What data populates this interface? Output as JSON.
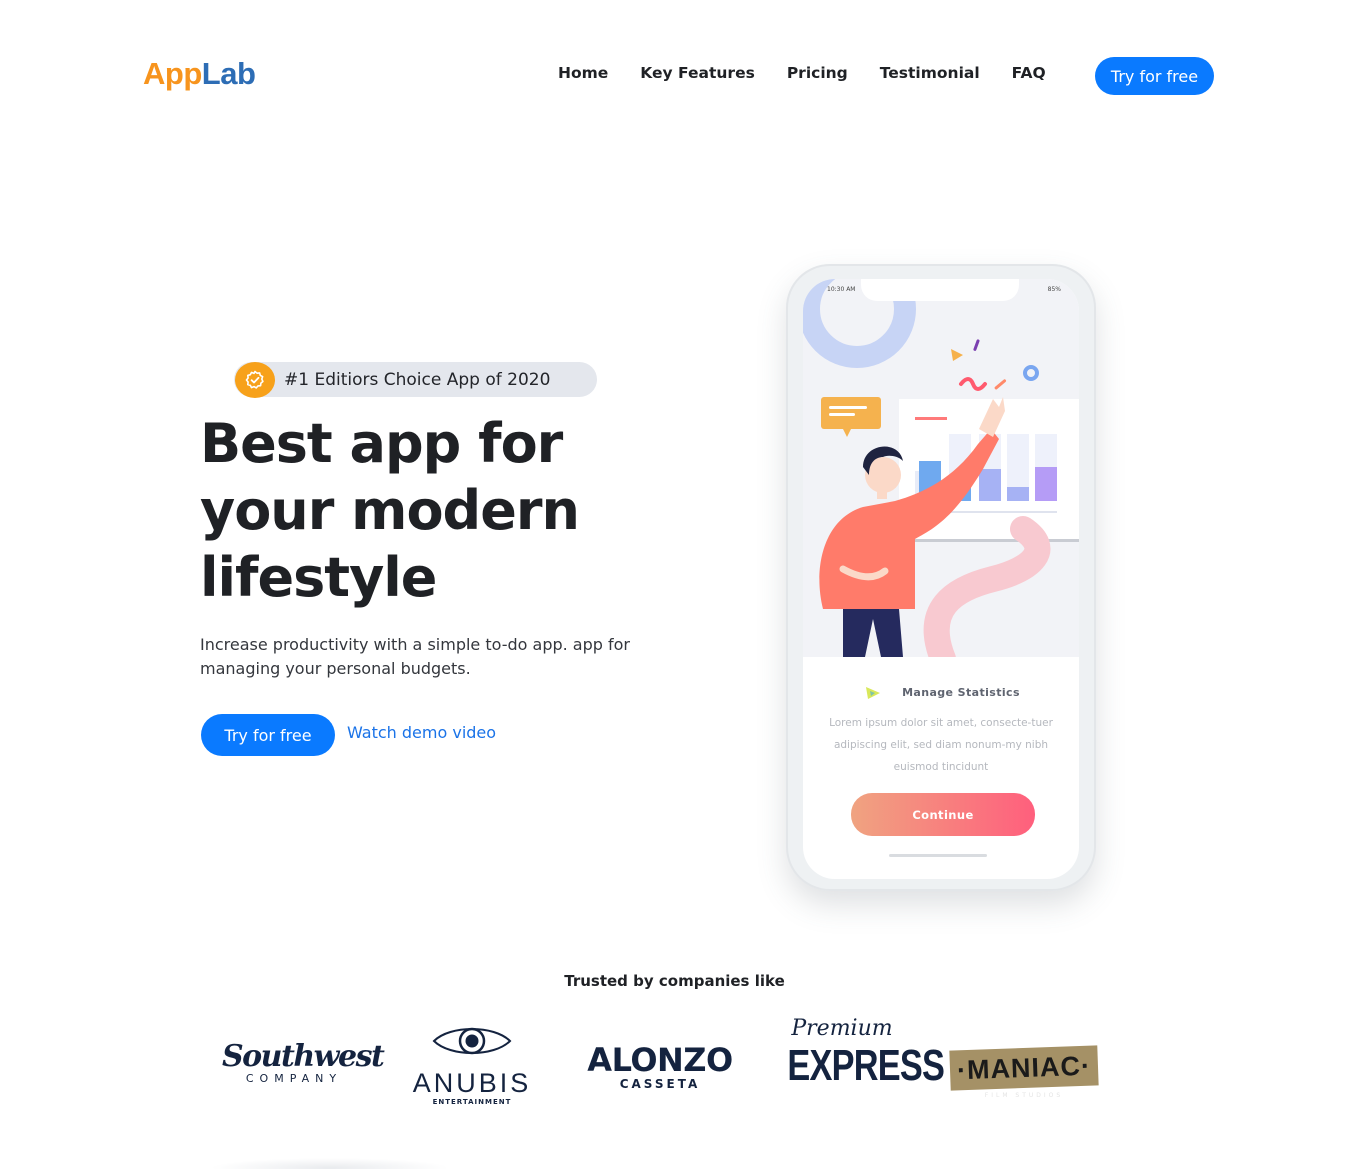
{
  "header": {
    "logo_part1": "App",
    "logo_part2": "Lab",
    "nav": [
      "Home",
      "Key Features",
      "Pricing",
      "Testimonial",
      "FAQ"
    ],
    "cta": "Try for free"
  },
  "hero": {
    "badge": "#1 Editiors Choice App of 2020",
    "title_line1": "Best app for",
    "title_line2": "your modern",
    "title_line3": "lifestyle",
    "description": "Increase productivity with a simple to-do app. app for managing your personal budgets.",
    "primary_button": "Try for free",
    "secondary_link": "Watch demo video"
  },
  "phone": {
    "status_time": "10:30 AM",
    "status_battery": "85%",
    "card_title": "Manage Statistics",
    "card_text": "Lorem ipsum dolor sit amet, consecte-tuer adipiscing elit, sed diam nonum-my nibh euismod tincidunt",
    "button": "Continue"
  },
  "trusted": {
    "heading": "Trusted by companies like",
    "brands": [
      {
        "name": "Southwest",
        "sub": "COMPANY"
      },
      {
        "name": "ANUBIS",
        "sub": "ENTERTAINMENT"
      },
      {
        "name": "ALONZO",
        "sub": "CASSETA"
      },
      {
        "name_top": "Premium",
        "name": "EXPRESS"
      },
      {
        "name": "·MANIAC·",
        "sub": "FILM STUDIOS"
      }
    ]
  },
  "colors": {
    "primary": "#0a7aff",
    "logo_orange": "#f7941d",
    "logo_blue": "#2d6db5",
    "badge_icon": "#f7a11a",
    "text_dark": "#1f2125"
  }
}
